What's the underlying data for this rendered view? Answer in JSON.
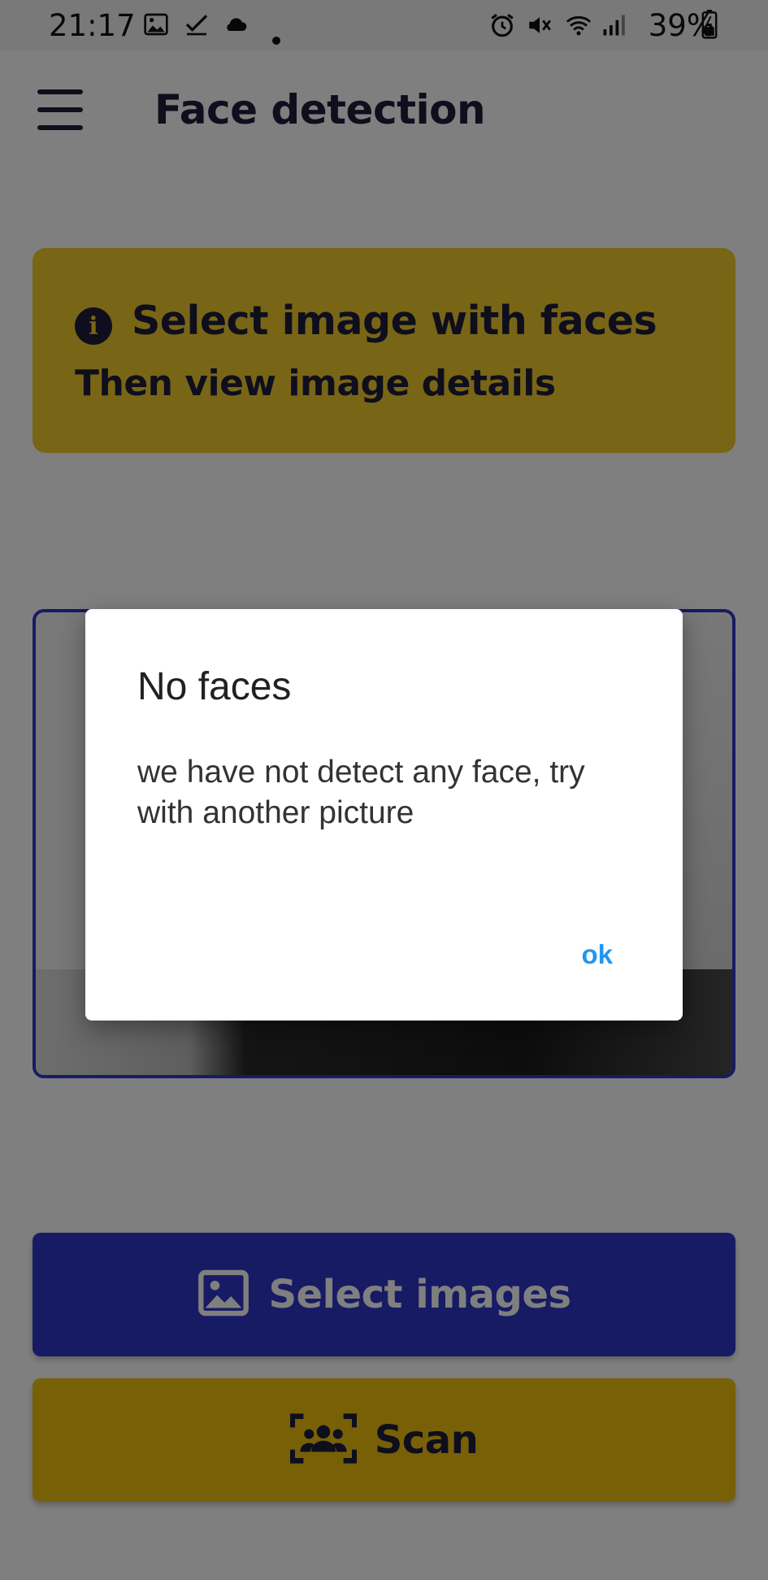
{
  "status_bar": {
    "time": "21:17",
    "battery": "39%",
    "left_icons": [
      "image-icon",
      "check-icon",
      "cloud-icon",
      "dot-icon"
    ],
    "right_icons": [
      "alarm-icon",
      "mute-icon",
      "wifi-icon",
      "signal-icon",
      "battery-icon"
    ]
  },
  "app_bar": {
    "title": "Face detection",
    "menu_icon": "hamburger-menu-icon"
  },
  "info_card": {
    "icon": "info-icon",
    "icon_glyph": "i",
    "title": "Select image with faces",
    "subtitle": "Then view image details",
    "color": "#f1cd2d"
  },
  "buttons": {
    "select_images": {
      "label": "Select images",
      "icon": "image-icon",
      "color": "#2e36c8"
    },
    "scan": {
      "label": "Scan",
      "icon": "face-scan-icon",
      "color": "#f1c10f"
    }
  },
  "dialog": {
    "title": "No faces",
    "message": "we have not detect any face, try with another picture",
    "ok_label": "ok",
    "accent_color": "#2196f3"
  }
}
